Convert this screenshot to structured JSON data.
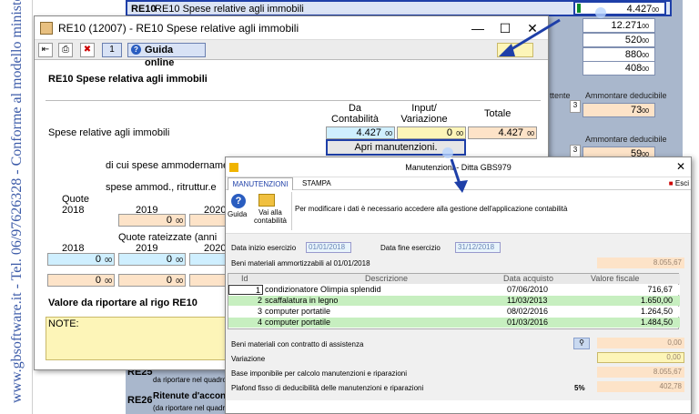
{
  "sidebar": {
    "vertical_text": "www.gbsoftware.it - Tel. 06/97626328 - Conforme al modello ministeriale"
  },
  "bg": {
    "header": "RE10 Spese relative agli immobili",
    "values": [
      "4.427",
      "12.271",
      "520",
      "880",
      "408"
    ],
    "dec": "00",
    "amm_label_1": "Ammontare deducibile",
    "amm_label_2": "Ammontare deducibile",
    "ritenute_suffix": "ttente",
    "amm_val_1": "73",
    "amm_val_2": "59",
    "amm_prefix": "3",
    "re25": "RE25",
    "re25_sub": "da riportare nel quadro",
    "re26": "RE26",
    "re26_label": "Ritenute d'acconto",
    "re26_sub": "(da riportare nel quadro"
  },
  "win1": {
    "title": "RE10 (12007) - RE10 Spese relative agli immobili",
    "num": "1",
    "guida": "Guida online",
    "heading": "RE10  Spese relativa agli immobili",
    "col_da": "Da Contabilità",
    "col_input": "Input/ Variazione",
    "col_totale": "Totale",
    "row_label": "Spese relative agli immobili",
    "da_val": "4.427",
    "input_val": "0",
    "totale_val": "4.427",
    "dec": "00",
    "apri_btn": "Apri manutenzioni.",
    "ammortamento": "di cui spese ammodername",
    "ammod": "spese ammod., ritruttur.e",
    "quote": "Quote",
    "years_a": [
      "2018",
      "2019",
      "2020"
    ],
    "quote_rate": "Quote rateizzate  (anni",
    "years_b": [
      "2018",
      "2019",
      "2020"
    ],
    "zero": "0",
    "valore": "Valore da riportare al rigo RE10",
    "note": "NOTE:"
  },
  "win2": {
    "title": "Manutenzioni - Ditta GBS979",
    "tab_man": "MANUTENZIONI",
    "tab_stampa": "STAMPA",
    "esci": "Esci",
    "guida": "Guida",
    "vai": "Vai alla contabilità",
    "info": "Per modificare i dati è necessario accedere alla gestione dell'applicazione contabilità",
    "data_inizio_label": "Data inizio esercizio",
    "data_inizio": "01/01/2018",
    "data_fine_label": "Data fine esercizio",
    "data_fine": "31/12/2018",
    "beni_label": "Beni materiali ammortizzabili al 01/01/2018",
    "beni_val": "8.055,67",
    "cols": [
      "Id",
      "Descrizione",
      "Data acquisto",
      "Valore fiscale"
    ],
    "rows": [
      {
        "id": "1",
        "desc": "condizionatore Olimpia splendid",
        "date": "07/06/2010",
        "val": "716,67"
      },
      {
        "id": "2",
        "desc": "scaffalatura in legno",
        "date": "11/03/2013",
        "val": "1.650,00"
      },
      {
        "id": "3",
        "desc": "computer portatile",
        "date": "08/02/2016",
        "val": "1.264,50"
      },
      {
        "id": "4",
        "desc": "computer portatile",
        "date": "01/03/2016",
        "val": "1.484,50"
      }
    ],
    "contratto_label": "Beni materiali con contratto di assistenza",
    "contratto_val": "0,00",
    "variazione_label": "Variazione",
    "variazione_val": "0,00",
    "base_label": "Base imponibile per calcolo manutenzioni e riparazioni",
    "base_val": "8.055,67",
    "plafond_label": "Plafond fisso di deducibilità delle manutenzioni e riparazioni",
    "plafond_pct": "5%",
    "plafond_val": "402,78"
  },
  "colors": {
    "accent": "#1e3fa8",
    "peach": "#fde3c8",
    "green": "#c7efc0",
    "cyan": "#cfefff",
    "yellow": "#fdf5b8"
  }
}
